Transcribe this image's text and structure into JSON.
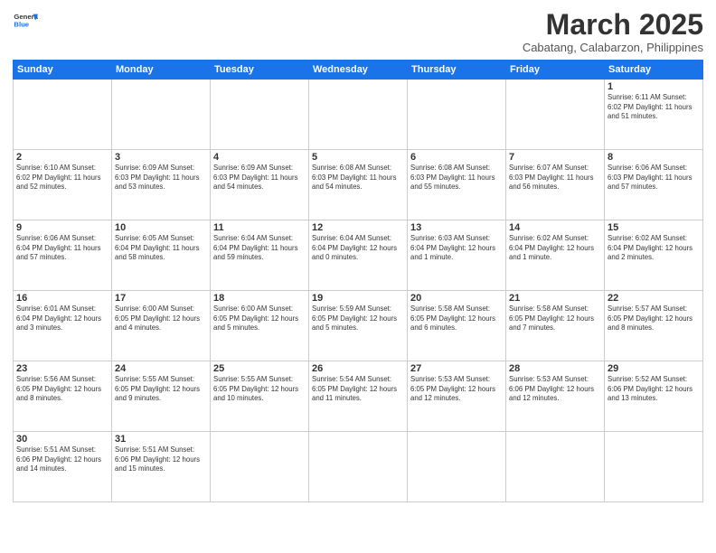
{
  "header": {
    "logo_line1": "General",
    "logo_line2": "Blue",
    "title": "March 2025",
    "subtitle": "Cabatang, Calabarzon, Philippines"
  },
  "weekdays": [
    "Sunday",
    "Monday",
    "Tuesday",
    "Wednesday",
    "Thursday",
    "Friday",
    "Saturday"
  ],
  "weeks": [
    [
      {
        "day": "",
        "info": ""
      },
      {
        "day": "",
        "info": ""
      },
      {
        "day": "",
        "info": ""
      },
      {
        "day": "",
        "info": ""
      },
      {
        "day": "",
        "info": ""
      },
      {
        "day": "",
        "info": ""
      },
      {
        "day": "1",
        "info": "Sunrise: 6:11 AM\nSunset: 6:02 PM\nDaylight: 11 hours\nand 51 minutes."
      }
    ],
    [
      {
        "day": "2",
        "info": "Sunrise: 6:10 AM\nSunset: 6:02 PM\nDaylight: 11 hours\nand 52 minutes."
      },
      {
        "day": "3",
        "info": "Sunrise: 6:09 AM\nSunset: 6:03 PM\nDaylight: 11 hours\nand 53 minutes."
      },
      {
        "day": "4",
        "info": "Sunrise: 6:09 AM\nSunset: 6:03 PM\nDaylight: 11 hours\nand 54 minutes."
      },
      {
        "day": "5",
        "info": "Sunrise: 6:08 AM\nSunset: 6:03 PM\nDaylight: 11 hours\nand 54 minutes."
      },
      {
        "day": "6",
        "info": "Sunrise: 6:08 AM\nSunset: 6:03 PM\nDaylight: 11 hours\nand 55 minutes."
      },
      {
        "day": "7",
        "info": "Sunrise: 6:07 AM\nSunset: 6:03 PM\nDaylight: 11 hours\nand 56 minutes."
      },
      {
        "day": "8",
        "info": "Sunrise: 6:06 AM\nSunset: 6:03 PM\nDaylight: 11 hours\nand 57 minutes."
      }
    ],
    [
      {
        "day": "9",
        "info": "Sunrise: 6:06 AM\nSunset: 6:04 PM\nDaylight: 11 hours\nand 57 minutes."
      },
      {
        "day": "10",
        "info": "Sunrise: 6:05 AM\nSunset: 6:04 PM\nDaylight: 11 hours\nand 58 minutes."
      },
      {
        "day": "11",
        "info": "Sunrise: 6:04 AM\nSunset: 6:04 PM\nDaylight: 11 hours\nand 59 minutes."
      },
      {
        "day": "12",
        "info": "Sunrise: 6:04 AM\nSunset: 6:04 PM\nDaylight: 12 hours\nand 0 minutes."
      },
      {
        "day": "13",
        "info": "Sunrise: 6:03 AM\nSunset: 6:04 PM\nDaylight: 12 hours\nand 1 minute."
      },
      {
        "day": "14",
        "info": "Sunrise: 6:02 AM\nSunset: 6:04 PM\nDaylight: 12 hours\nand 1 minute."
      },
      {
        "day": "15",
        "info": "Sunrise: 6:02 AM\nSunset: 6:04 PM\nDaylight: 12 hours\nand 2 minutes."
      }
    ],
    [
      {
        "day": "16",
        "info": "Sunrise: 6:01 AM\nSunset: 6:04 PM\nDaylight: 12 hours\nand 3 minutes."
      },
      {
        "day": "17",
        "info": "Sunrise: 6:00 AM\nSunset: 6:05 PM\nDaylight: 12 hours\nand 4 minutes."
      },
      {
        "day": "18",
        "info": "Sunrise: 6:00 AM\nSunset: 6:05 PM\nDaylight: 12 hours\nand 5 minutes."
      },
      {
        "day": "19",
        "info": "Sunrise: 5:59 AM\nSunset: 6:05 PM\nDaylight: 12 hours\nand 5 minutes."
      },
      {
        "day": "20",
        "info": "Sunrise: 5:58 AM\nSunset: 6:05 PM\nDaylight: 12 hours\nand 6 minutes."
      },
      {
        "day": "21",
        "info": "Sunrise: 5:58 AM\nSunset: 6:05 PM\nDaylight: 12 hours\nand 7 minutes."
      },
      {
        "day": "22",
        "info": "Sunrise: 5:57 AM\nSunset: 6:05 PM\nDaylight: 12 hours\nand 8 minutes."
      }
    ],
    [
      {
        "day": "23",
        "info": "Sunrise: 5:56 AM\nSunset: 6:05 PM\nDaylight: 12 hours\nand 8 minutes."
      },
      {
        "day": "24",
        "info": "Sunrise: 5:55 AM\nSunset: 6:05 PM\nDaylight: 12 hours\nand 9 minutes."
      },
      {
        "day": "25",
        "info": "Sunrise: 5:55 AM\nSunset: 6:05 PM\nDaylight: 12 hours\nand 10 minutes."
      },
      {
        "day": "26",
        "info": "Sunrise: 5:54 AM\nSunset: 6:05 PM\nDaylight: 12 hours\nand 11 minutes."
      },
      {
        "day": "27",
        "info": "Sunrise: 5:53 AM\nSunset: 6:05 PM\nDaylight: 12 hours\nand 12 minutes."
      },
      {
        "day": "28",
        "info": "Sunrise: 5:53 AM\nSunset: 6:06 PM\nDaylight: 12 hours\nand 12 minutes."
      },
      {
        "day": "29",
        "info": "Sunrise: 5:52 AM\nSunset: 6:06 PM\nDaylight: 12 hours\nand 13 minutes."
      }
    ],
    [
      {
        "day": "30",
        "info": "Sunrise: 5:51 AM\nSunset: 6:06 PM\nDaylight: 12 hours\nand 14 minutes."
      },
      {
        "day": "31",
        "info": "Sunrise: 5:51 AM\nSunset: 6:06 PM\nDaylight: 12 hours\nand 15 minutes."
      },
      {
        "day": "",
        "info": ""
      },
      {
        "day": "",
        "info": ""
      },
      {
        "day": "",
        "info": ""
      },
      {
        "day": "",
        "info": ""
      },
      {
        "day": "",
        "info": ""
      }
    ]
  ]
}
